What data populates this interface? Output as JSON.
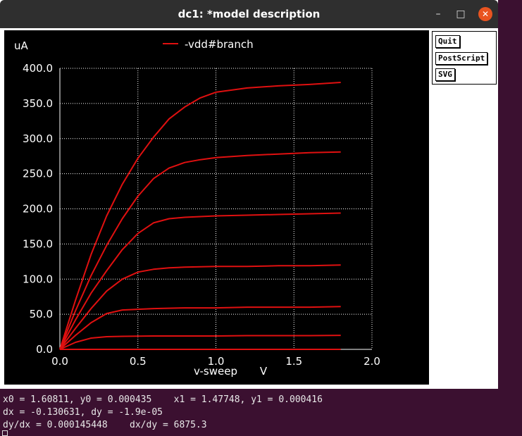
{
  "window": {
    "title": "dc1: *model description",
    "minimize_icon": "minimize-icon",
    "maximize_icon": "maximize-icon",
    "close_icon": "close-icon"
  },
  "buttons": {
    "quit": "Quit",
    "postscript": "PostScript",
    "svg": "SVG"
  },
  "readout": {
    "line1": "x0 = 1.60811, y0 = 0.000435    x1 = 1.47748, y1 = 0.000416",
    "line2": "dx = -0.130631, dy = -1.9e-05",
    "line3": "dy/dx = 0.000145448    dx/dy = 6875.3"
  },
  "colors": {
    "background": "#000000",
    "trace": "#e01010",
    "grid": "#ffffff",
    "text": "#ffffff"
  },
  "chart_data": {
    "type": "line",
    "title": "",
    "xlabel": "v-sweep",
    "xunit": "V",
    "ylabel": "uA",
    "xlim": [
      0,
      2.0
    ],
    "ylim": [
      0,
      400
    ],
    "xticks": [
      "0.0",
      "0.5",
      "1.0",
      "1.5",
      "2.0"
    ],
    "yticks": [
      "0.0",
      "50.0",
      "100.0",
      "150.0",
      "200.0",
      "250.0",
      "300.0",
      "350.0",
      "400.0"
    ],
    "grid": true,
    "legend": "top-center",
    "series": [
      {
        "name": "-vdd#branch",
        "x": [
          0,
          0.1,
          0.2,
          0.3,
          0.4,
          0.5,
          0.6,
          0.7,
          0.8,
          0.9,
          1.0,
          1.2,
          1.4,
          1.6,
          1.8
        ],
        "values": [
          0,
          70,
          135,
          190,
          235,
          272,
          302,
          328,
          345,
          358,
          366,
          372,
          375,
          377,
          380
        ]
      },
      {
        "name": "-vdd#branch",
        "x": [
          0,
          0.1,
          0.2,
          0.3,
          0.4,
          0.5,
          0.6,
          0.7,
          0.8,
          0.9,
          1.0,
          1.2,
          1.4,
          1.6,
          1.8
        ],
        "values": [
          0,
          55,
          105,
          148,
          186,
          218,
          243,
          258,
          266,
          270,
          273,
          276,
          278,
          280,
          281
        ]
      },
      {
        "name": "-vdd#branch",
        "x": [
          0,
          0.1,
          0.2,
          0.3,
          0.4,
          0.5,
          0.6,
          0.7,
          0.8,
          1.0,
          1.2,
          1.4,
          1.6,
          1.8
        ],
        "values": [
          0,
          42,
          80,
          112,
          142,
          165,
          180,
          186,
          188,
          190,
          191,
          192,
          193,
          194
        ]
      },
      {
        "name": "-vdd#branch",
        "x": [
          0,
          0.1,
          0.2,
          0.3,
          0.4,
          0.5,
          0.6,
          0.7,
          0.8,
          1.0,
          1.2,
          1.4,
          1.6,
          1.8
        ],
        "values": [
          0,
          30,
          58,
          83,
          100,
          110,
          114,
          116,
          117,
          118,
          118,
          119,
          119,
          120
        ]
      },
      {
        "name": "-vdd#branch",
        "x": [
          0,
          0.1,
          0.2,
          0.3,
          0.4,
          0.5,
          0.6,
          0.8,
          1.0,
          1.2,
          1.4,
          1.6,
          1.8
        ],
        "values": [
          0,
          20,
          38,
          51,
          56,
          57,
          58,
          59,
          59,
          60,
          60,
          60,
          61
        ]
      },
      {
        "name": "-vdd#branch",
        "x": [
          0,
          0.1,
          0.2,
          0.3,
          0.4,
          0.6,
          0.8,
          1.0,
          1.2,
          1.4,
          1.6,
          1.8
        ],
        "values": [
          0,
          10,
          16,
          18,
          18.5,
          19,
          19,
          19,
          19.5,
          19.5,
          19.5,
          20
        ]
      },
      {
        "name": "-vdd#branch",
        "x": [
          0,
          0.5,
          1.0,
          1.5,
          1.8
        ],
        "values": [
          0,
          0,
          0,
          0,
          0
        ]
      }
    ]
  }
}
